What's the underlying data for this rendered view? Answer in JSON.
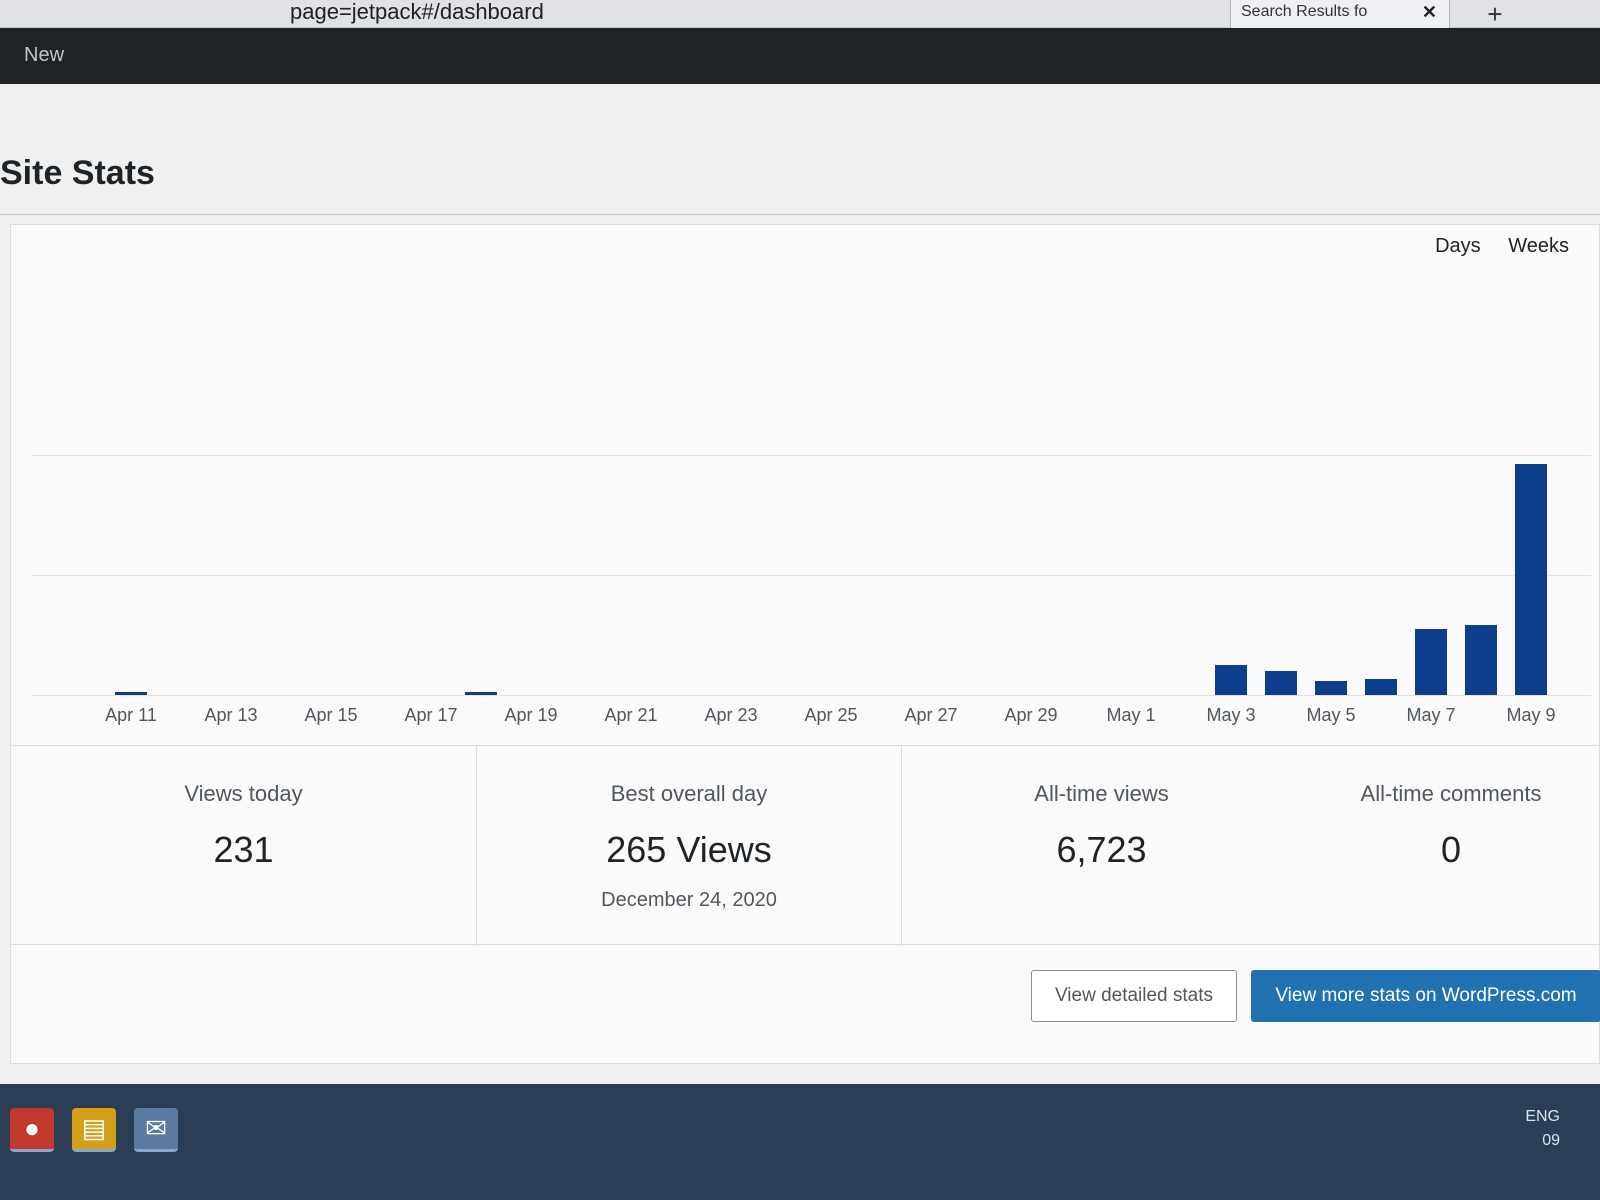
{
  "browser": {
    "url": "page=jetpack#/dashboard",
    "tab_title": "Search Results fo",
    "tab_close": "✕",
    "new_tab": "+"
  },
  "admin_bar": {
    "new_label": "New"
  },
  "page": {
    "title": "Site Stats"
  },
  "range_toggle": {
    "days": "Days",
    "weeks": "Weeks"
  },
  "chart_data": {
    "type": "bar",
    "categories": [
      "Apr 11",
      "Apr 12",
      "Apr 13",
      "Apr 14",
      "Apr 15",
      "Apr 16",
      "Apr 17",
      "Apr 18",
      "Apr 19",
      "Apr 20",
      "Apr 21",
      "Apr 22",
      "Apr 23",
      "Apr 24",
      "Apr 25",
      "Apr 26",
      "Apr 27",
      "Apr 28",
      "Apr 29",
      "Apr 30",
      "May 1",
      "May 2",
      "May 3",
      "May 4",
      "May 5",
      "May 6",
      "May 7",
      "May 8",
      "May 9"
    ],
    "values": [
      1,
      0,
      0,
      0,
      0,
      0,
      0,
      1,
      0,
      0,
      0,
      0,
      0,
      0,
      0,
      0,
      0,
      0,
      0,
      0,
      0,
      0,
      30,
      24,
      14,
      16,
      66,
      70,
      231
    ],
    "tick_labels": [
      "Apr 11",
      "Apr 13",
      "Apr 15",
      "Apr 17",
      "Apr 19",
      "Apr 21",
      "Apr 23",
      "Apr 25",
      "Apr 27",
      "Apr 29",
      "May 1",
      "May 3",
      "May 5",
      "May 7",
      "May 9"
    ],
    "ylim": [
      0,
      240
    ],
    "bar_color": "#0d3e8c"
  },
  "stats": [
    {
      "label": "Views today",
      "value": "231",
      "sub": ""
    },
    {
      "label": "Best overall day",
      "value": "265 Views",
      "sub": "December 24, 2020"
    },
    {
      "label": "All-time views",
      "value": "6,723",
      "sub": ""
    },
    {
      "label": "All-time comments",
      "value": "0",
      "sub": ""
    }
  ],
  "buttons": {
    "detailed": "View detailed stats",
    "wpcom": "View more stats on WordPress.com"
  },
  "taskbar": {
    "apps": [
      "chrome-icon",
      "file-explorer-icon",
      "mail-icon"
    ],
    "lang": "ENG",
    "time": "09"
  },
  "colors": {
    "accent": "#2271b1",
    "admin_bar": "#1d2327",
    "bar": "#0d3e8c"
  }
}
